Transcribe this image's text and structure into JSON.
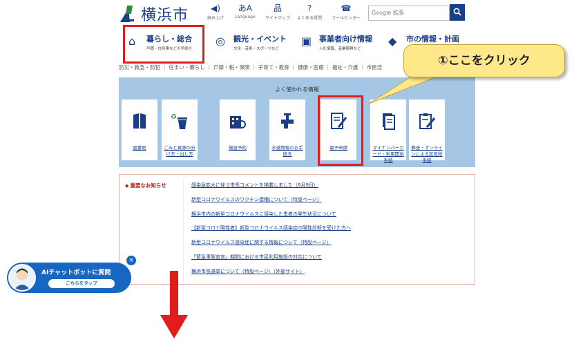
{
  "header": {
    "logo_text": "横浜市",
    "utility": [
      {
        "icon": "speaker-icon",
        "glyph": "◀)",
        "label": "読み上げ"
      },
      {
        "icon": "language-icon",
        "glyph": "あA",
        "label": "Language"
      },
      {
        "icon": "sitemap-icon",
        "glyph": "品",
        "label": "サイトマップ"
      },
      {
        "icon": "faq-icon",
        "glyph": "?",
        "label": "よくある質問"
      },
      {
        "icon": "call-center-icon",
        "glyph": "☎",
        "label": "コールセンター"
      }
    ],
    "search_placeholder": "Google 拡張",
    "search_button": "🔍"
  },
  "nav": [
    {
      "title": "暮らし・総合",
      "sub": "戸籍・住民票などの手続き",
      "icon": "home-icon",
      "glyph": "⌂"
    },
    {
      "title": "観光・イベント",
      "sub": "文化・芸術・スポーツなど",
      "icon": "camera-icon",
      "glyph": "◎"
    },
    {
      "title": "事業者向け情報",
      "sub": "入札情報、産業振興など",
      "icon": "business-icon",
      "glyph": "▣"
    },
    {
      "title": "市の情報・計画",
      "sub": "",
      "icon": "city-icon",
      "glyph": "◆"
    }
  ],
  "subnav": "防災・救急・防犯 ｜ 住まい・暮らし ｜ 戸籍・税・保険 ｜ 子育て・教育 ｜ 健康・医療 ｜ 福祉・介護 ｜ 市民活",
  "callout": "①ここをクリック",
  "faq": {
    "title": "よく使われる情報",
    "tiles": [
      {
        "label": "図書館",
        "icon": "library-icon",
        "glyph": "▮"
      },
      {
        "label": "ごみと資源の分け方・出し方",
        "icon": "recycle-bin-icon",
        "glyph": "♻"
      },
      {
        "label": "施設予約",
        "icon": "facility-icon",
        "glyph": "▦"
      },
      {
        "label": "水道開栓のお手続き",
        "icon": "faucet-icon",
        "glyph": "⚲"
      },
      {
        "label": "電子申請",
        "icon": "application-form-icon",
        "glyph": "✎"
      },
      {
        "label": "マイナンバーカード・利用開始手続",
        "icon": "mynumber-card-icon",
        "glyph": "▤"
      },
      {
        "label": "郵送・オンラインによる区役所手続",
        "icon": "online-form-icon",
        "glyph": "✎"
      }
    ]
  },
  "notice": {
    "label": "重要なお知らせ",
    "tag_glyph": "◆",
    "items": [
      "感染急拡大に伴う市長コメントを掲載しました（8月9日）",
      "新型コロナウイルスのワクチン接種について（特設ページ）",
      "横浜市内の新型コロナウイルスに感染した患者の発生状況について",
      "【新型コロナ陽性者】新型コロナウイルス感染症の陽性診断を受けた方へ",
      "新型コロナウイルス感染症に関する情報について（特設ページ）",
      "「緊急事態宣言」期間における市民利用施設の対応について",
      "横浜市長選挙について（特設ページ）（外部サイト）"
    ]
  },
  "chatbot": {
    "title": "AIチャットボットに質問",
    "tap": "こちらをタップ",
    "close_glyph": "×"
  },
  "colors": {
    "brand": "#1a3f8a",
    "highlight": "#e21b1b",
    "band": "#a6c6e6",
    "callout": "#ffe88a",
    "chatbot": "#1766c2"
  }
}
